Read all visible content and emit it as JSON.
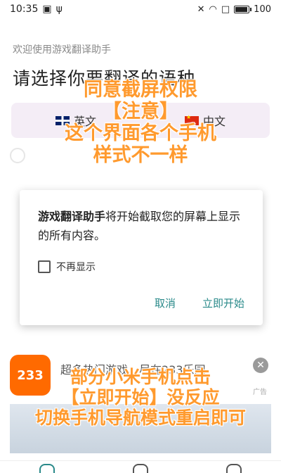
{
  "status_bar": {
    "time": "10:35",
    "battery_level": "100",
    "left_icons": [
      "image-icon",
      "usb-icon"
    ],
    "right_icons": [
      "mute-icon",
      "wifi-icon",
      "window-icon",
      "battery-icon"
    ]
  },
  "page": {
    "welcome": "欢迎使用游戏翻译助手",
    "select_title": "请选择你要翻译的语种"
  },
  "languages": {
    "source": {
      "label": "英文",
      "icon": "uk-flag-icon"
    },
    "target": {
      "label": "中文",
      "icon": "china-flag-icon"
    }
  },
  "overlay_top": {
    "line1": "同意截屏权限",
    "line2": "【注意】",
    "line3": "这个界面各个手机",
    "line4": "样式不一样"
  },
  "dialog": {
    "app_name": "游戏翻译助手",
    "message": "将开始截取您的屏幕上显示的所有内容。",
    "checkbox_label": "不再显示",
    "cancel": "取消",
    "start": "立即开始"
  },
  "ad": {
    "logo_text": "233",
    "title": "超多热门游戏，尽在233乐园",
    "ad_label": "广告"
  },
  "overlay_bottom": {
    "line1": "部分小米手机点击",
    "line2": "【立即开始】没反应",
    "line3": "切换手机导航模式重启即可"
  },
  "colors": {
    "overlay": "#ff9a2e",
    "dialog_action": "#2a8a8a",
    "ad_logo": "#ff6a00",
    "language_bar": "#f4edf6"
  }
}
